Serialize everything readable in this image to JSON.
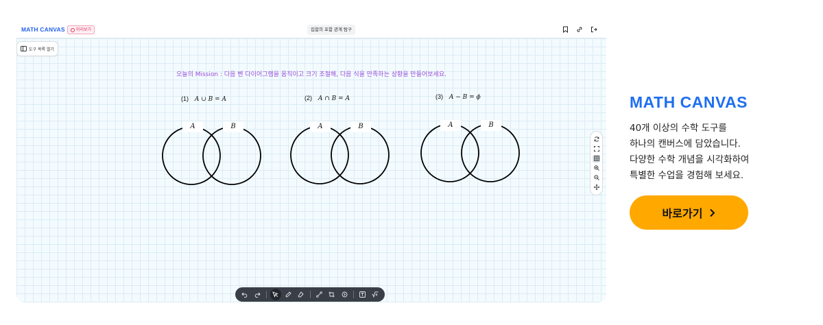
{
  "app": {
    "brand": "MATH CANVAS",
    "preview_badge": "미리보기",
    "document_title": "집합의 포함 관계 탐구",
    "top_icons": [
      "bookmark-icon",
      "link-icon",
      "exit-icon"
    ]
  },
  "canvas": {
    "sidebar_toggle": "도구 목록 열기",
    "mission": "오늘의 Mission : 다음 벤 다이어그램을 움직이고 크기 조절해, 다음 식을 만족하는 상황을 만들어보세요.",
    "problems": [
      {
        "num": "(1)",
        "expr": "A ∪ B = A",
        "set_a": "A",
        "set_b": "B"
      },
      {
        "num": "(2)",
        "expr": "A ∩ B = A",
        "set_a": "A",
        "set_b": "B"
      },
      {
        "num": "(3)",
        "expr": "A − B = ϕ",
        "set_a": "A",
        "set_b": "B"
      }
    ],
    "right_tools": [
      "refresh-icon",
      "fullscreen-icon",
      "grid-icon",
      "zoom-in-icon",
      "zoom-out-icon",
      "move-icon"
    ],
    "bottom_tools": [
      "undo-icon",
      "redo-icon",
      "select-icon",
      "pen-icon",
      "eraser-icon",
      "segment-icon",
      "crop-icon",
      "shape-icon",
      "text-icon",
      "sqrt-icon"
    ]
  },
  "promo": {
    "brand": "MATH CANVAS",
    "desc_lines": [
      "40개 이상의 수학 도구를",
      "하나의 캔버스에 담았습니다.",
      "다양한 수학 개념을 시각화하여",
      "특별한 수업을 경험해 보세요."
    ],
    "cta_label": "바로가기"
  },
  "colors": {
    "brand_blue": "#1e6ff0",
    "cta_orange": "#ffa800",
    "mission_purple": "#9b4fd8",
    "badge_pink": "#e0305e"
  }
}
